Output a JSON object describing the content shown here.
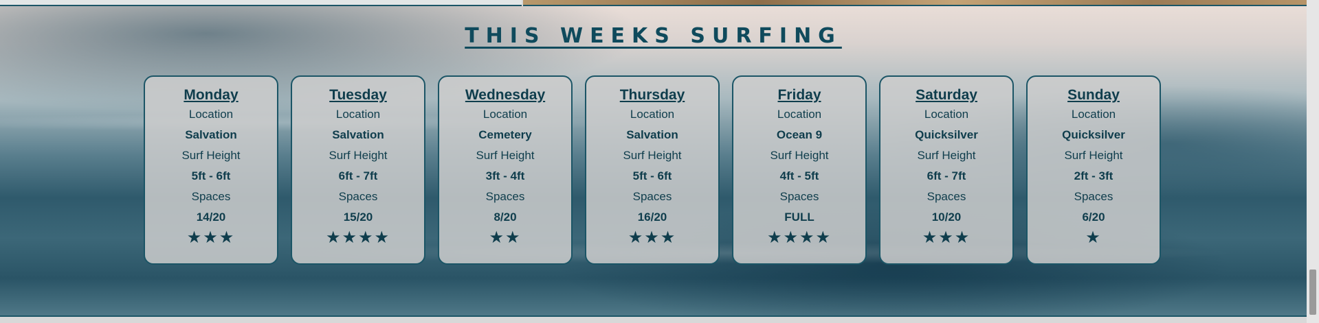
{
  "section": {
    "title": "THIS WEEKS SURFING"
  },
  "days": [
    {
      "day": "Monday",
      "location_label": "Location",
      "location": "Salvation",
      "height_label": "Surf Height",
      "height": "5ft - 6ft",
      "spaces_label": "Spaces",
      "spaces": "14/20",
      "rating": 3
    },
    {
      "day": "Tuesday",
      "location_label": "Location",
      "location": "Salvation",
      "height_label": "Surf Height",
      "height": "6ft - 7ft",
      "spaces_label": "Spaces",
      "spaces": "15/20",
      "rating": 4
    },
    {
      "day": "Wednesday",
      "location_label": "Location",
      "location": "Cemetery",
      "height_label": "Surf Height",
      "height": "3ft - 4ft",
      "spaces_label": "Spaces",
      "spaces": "8/20",
      "rating": 2
    },
    {
      "day": "Thursday",
      "location_label": "Location",
      "location": "Salvation",
      "height_label": "Surf Height",
      "height": "5ft - 6ft",
      "spaces_label": "Spaces",
      "spaces": "16/20",
      "rating": 3
    },
    {
      "day": "Friday",
      "location_label": "Location",
      "location": "Ocean 9",
      "height_label": "Surf Height",
      "height": "4ft - 5ft",
      "spaces_label": "Spaces",
      "spaces": "FULL",
      "rating": 4
    },
    {
      "day": "Saturday",
      "location_label": "Location",
      "location": "Quicksilver",
      "height_label": "Surf Height",
      "height": "6ft - 7ft",
      "spaces_label": "Spaces",
      "spaces": "10/20",
      "rating": 3
    },
    {
      "day": "Sunday",
      "location_label": "Location",
      "location": "Quicksilver",
      "height_label": "Surf Height",
      "height": "2ft - 3ft",
      "spaces_label": "Spaces",
      "spaces": "6/20",
      "rating": 1
    }
  ],
  "colors": {
    "accent": "#0f4a5c",
    "card_border": "#1b5566",
    "card_bg": "#cdcdcd"
  },
  "icons": {
    "rating": "star-icon"
  }
}
